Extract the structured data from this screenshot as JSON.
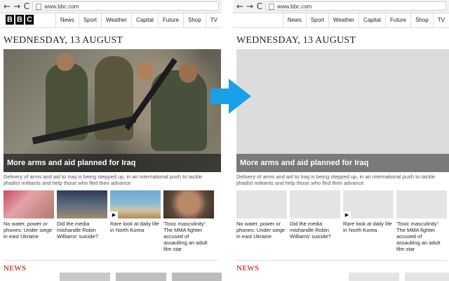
{
  "browser": {
    "back_icon": "←",
    "forward_icon": "→",
    "reload_icon": "C",
    "url": "www.bbc.com"
  },
  "logo": [
    "B",
    "B",
    "C"
  ],
  "nav": [
    "News",
    "Sport",
    "Weather",
    "Capital",
    "Future",
    "Shop",
    "TV"
  ],
  "date": "WEDNESDAY, 13 AUGUST",
  "hero": {
    "headline": "More arms and aid planned for Iraq",
    "summary": "Delivery of arms and aid to Iraq is being stepped up, in an international push to tackle jihadist militants and help those who fled their advance"
  },
  "stories": [
    {
      "headline": "No water, power or phones: Under siege in east Ukraine",
      "video": false
    },
    {
      "headline": "Did the media mishandle Robin Williams' suicide?",
      "video": false
    },
    {
      "headline": "Rare look at daily life in North Korea",
      "video": true
    },
    {
      "headline": "'Toxic masculinity': The MMA fighter accused of assaulting an adult film star",
      "video": false
    }
  ],
  "section_label": "NEWS",
  "accent_color": "#1aa0e6",
  "news_color": "#bb0000"
}
